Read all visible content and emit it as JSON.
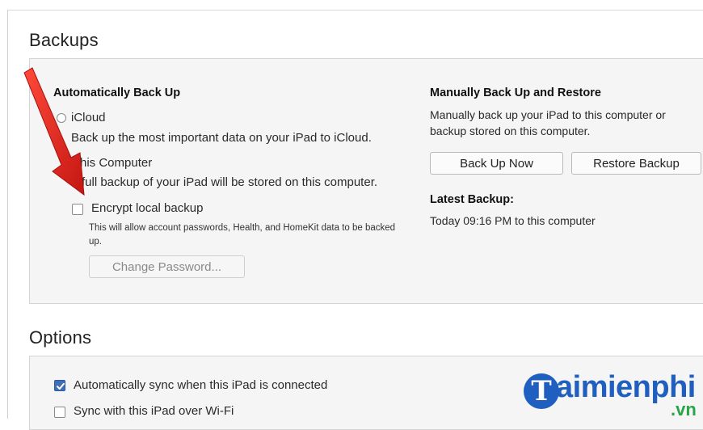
{
  "backups": {
    "title": "Backups",
    "auto": {
      "heading": "Automatically Back Up",
      "icloud_label": "iCloud",
      "icloud_desc": "Back up the most important data on your iPad to iCloud.",
      "computer_label": "his Computer",
      "computer_desc": "full backup of your iPad will be stored on this computer.",
      "encrypt_label": "Encrypt local backup",
      "encrypt_desc": "This will allow account passwords, Health, and HomeKit data to be backed up.",
      "change_password_label": "Change Password..."
    },
    "manual": {
      "heading": "Manually Back Up and Restore",
      "desc_line1": "Manually back up your iPad to this computer or",
      "desc_line2": "backup stored on this computer.",
      "back_up_now_label": "Back Up Now",
      "restore_backup_label": "Restore Backup",
      "latest_heading": "Latest Backup:",
      "latest_value": "Today 09:16 PM to this computer"
    }
  },
  "options": {
    "title": "Options",
    "auto_sync_label": "Automatically sync when this iPad is connected",
    "auto_sync_checked": true,
    "wifi_sync_label": "Sync with this iPad over Wi-Fi",
    "wifi_sync_checked": false
  },
  "watermark": {
    "logo_letter": "T",
    "logo_text": "aimienphi",
    "logo_tld": ".vn"
  },
  "colors": {
    "arrow": "#e0201c",
    "accent": "#3f6fb5",
    "logo_blue": "#1f5fbf",
    "logo_green": "#2aa44a"
  }
}
